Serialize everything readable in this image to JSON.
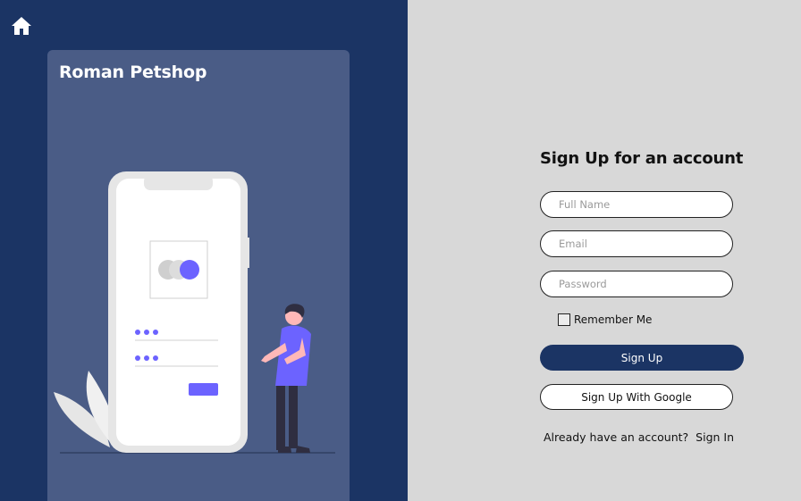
{
  "brand": {
    "name": "Roman Petshop"
  },
  "icons": {
    "home": "home-icon",
    "illustration": "signup-illustration"
  },
  "colors": {
    "navy": "#1b3464",
    "card": "#4a5c86",
    "accent": "#6c63ff",
    "background": "#d8d8d8"
  },
  "form": {
    "title": "Sign Up for an account",
    "full_name_placeholder": "Full Name",
    "email_placeholder": "Email",
    "password_placeholder": "Password",
    "remember_label": "Remember Me",
    "signup_label": "Sign Up",
    "google_label": "Sign Up With Google",
    "signin_prompt": "Already have an account?",
    "signin_link": "Sign In"
  }
}
